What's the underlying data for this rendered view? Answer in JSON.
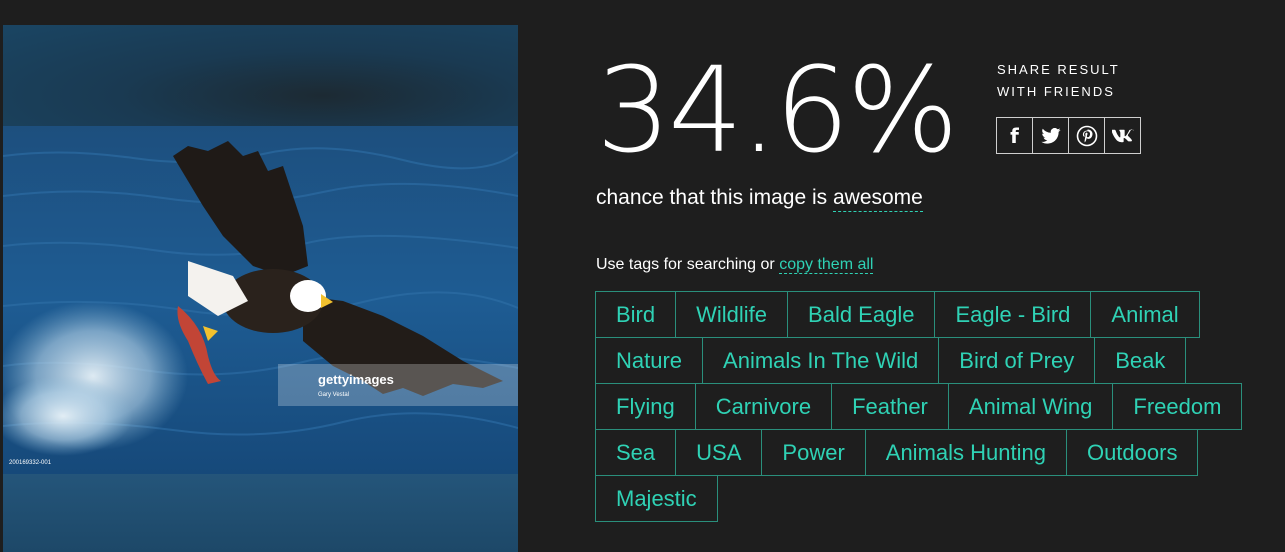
{
  "result": {
    "percentage": "34.6%",
    "caption_prefix": "chance that this image is",
    "caption_word": "awesome"
  },
  "share": {
    "title_line1": "SHARE RESULT",
    "title_line2": "WITH FRIENDS",
    "buttons": [
      {
        "name": "facebook",
        "icon": "facebook-icon",
        "glyph": "f"
      },
      {
        "name": "twitter",
        "icon": "twitter-icon"
      },
      {
        "name": "pinterest",
        "icon": "pinterest-icon"
      },
      {
        "name": "vk",
        "icon": "vk-icon"
      }
    ]
  },
  "tags_hint": {
    "prefix": "Use tags for searching or",
    "link": "copy them all"
  },
  "tags": [
    [
      "Bird",
      "Wildlife",
      "Bald Eagle",
      "Eagle - Bird",
      "Animal"
    ],
    [
      "Nature",
      "Animals In The Wild",
      "Bird of Prey",
      "Beak"
    ],
    [
      "Flying",
      "Carnivore",
      "Feather",
      "Animal Wing",
      "Freedom"
    ],
    [
      "Sea",
      "USA",
      "Power",
      "Animals Hunting",
      "Outdoors"
    ],
    [
      "Majestic"
    ]
  ],
  "photo": {
    "watermark_brand": "gettyimages",
    "watermark_credit": "Gary Vestal",
    "image_code": "200169332-001"
  },
  "colors": {
    "background": "#1e1e1e",
    "accent": "#2fd2b5",
    "tag_border": "#2a8f7c"
  }
}
